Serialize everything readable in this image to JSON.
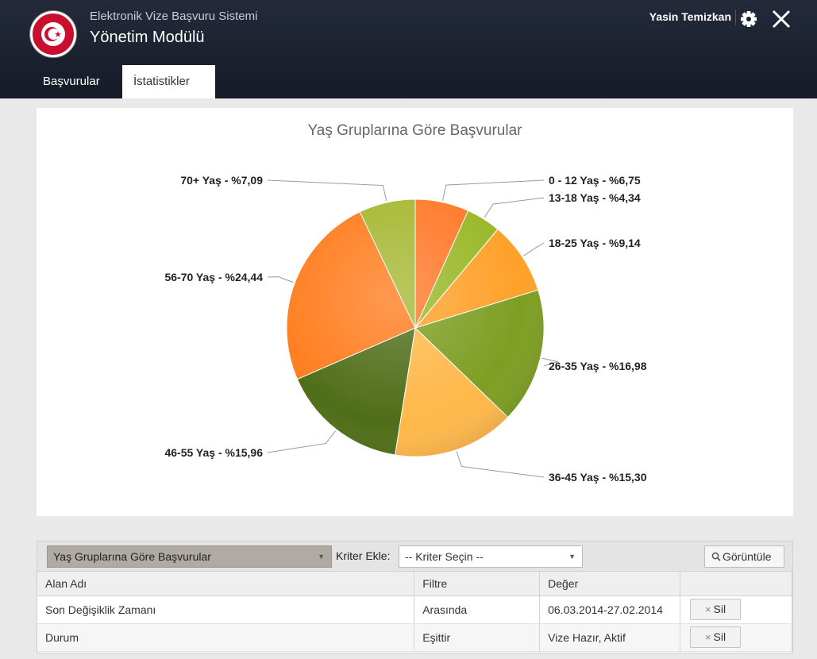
{
  "header": {
    "app_subtitle": "Elektronik Vize Başvuru Sistemi",
    "app_title": "Yönetim Modülü",
    "user_name": "Yasin Temizkan",
    "icons": {
      "logo": "turkish-emblem-logo",
      "settings": "gear-icon",
      "close": "close-icon"
    }
  },
  "tabs": [
    {
      "label": "Başvurular",
      "active": false
    },
    {
      "label": "İstatistikler",
      "active": true
    }
  ],
  "chart_data": {
    "type": "pie",
    "title": "Yaş Gruplarına Göre Başvurular",
    "categories": [
      "0 - 12 Yaş",
      "13-18 Yaş",
      "18-25 Yaş",
      "26-35 Yaş",
      "36-45 Yaş",
      "46-55 Yaş",
      "56-70 Yaş",
      "70+ Yaş"
    ],
    "values": [
      6.75,
      4.34,
      9.14,
      16.98,
      15.3,
      15.96,
      24.44,
      7.09
    ],
    "labels": [
      "0 - 12 Yaş - %6,75",
      "13-18 Yaş - %4,34",
      "18-25 Yaş - %9,14",
      "26-35 Yaş - %16,98",
      "36-45 Yaş - %15,30",
      "46-55 Yaş - %15,96",
      "56-70 Yaş - %24,44",
      "70+ Yaş - %7,09"
    ],
    "colors": [
      "#ff7a2a",
      "#9ab828",
      "#ffa12a",
      "#7d9e22",
      "#ffb84a",
      "#4f6e18",
      "#ff7d1e",
      "#a6b832"
    ]
  },
  "filters": {
    "report_select": "Yaş Gruplarına Göre Başvurular",
    "criteria_label": "Kriter Ekle:",
    "criteria_select": "-- Kriter Seçin --",
    "show_button": "Görüntüle",
    "columns": [
      "Alan Adı",
      "Filtre",
      "Değer",
      ""
    ],
    "rows": [
      {
        "field": "Son Değişiklik Zamanı",
        "filter": "Arasında",
        "value": "06.03.2014-27.02.2014",
        "action": "Sil"
      },
      {
        "field": "Durum",
        "filter": "Eşittir",
        "value": "Vize Hazır, Aktif",
        "action": "Sil"
      }
    ]
  }
}
